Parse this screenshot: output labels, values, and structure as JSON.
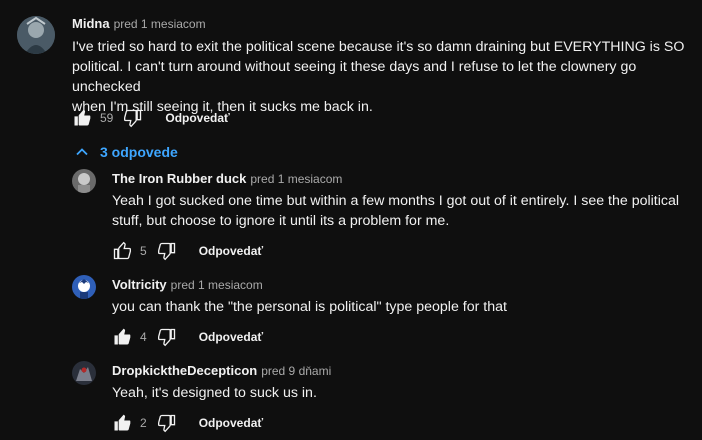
{
  "main_comment": {
    "author": "Midna",
    "time": "pred 1 mesiacom",
    "lines": [
      "I've tried so hard to exit the political scene because it's so damn draining but EVERYTHING is SO",
      "political. I can't turn around without seeing it these days and I refuse to let the clownery go unchecked",
      "when I'm still seeing it, then it sucks me back in."
    ],
    "likes": "59",
    "reply_label": "Odpovedať",
    "liked": true
  },
  "replies_toggle": {
    "label": "3 odpovede",
    "icon": "chevron-up-icon"
  },
  "replies": [
    {
      "author": "The Iron Rubber duck",
      "time": "pred 1 mesiacom",
      "lines": [
        "Yeah I got sucked one time but within a few months I got out of it entirely. I see the political",
        "stuff, but choose to ignore it until its a problem for me."
      ],
      "likes": "5",
      "reply_label": "Odpovedať",
      "liked": false
    },
    {
      "author": "Voltricity",
      "time": "pred 1 mesiacom",
      "lines": [
        "you can thank the \"the personal is political\" type people for that"
      ],
      "likes": "4",
      "reply_label": "Odpovedať",
      "liked": true
    },
    {
      "author": "DropkicktheDecepticon",
      "time": "pred 9 dňami",
      "lines": [
        "Yeah, it's designed to suck us in."
      ],
      "likes": "2",
      "reply_label": "Odpovedať",
      "liked": true
    }
  ],
  "colors": {
    "background": "#0f0f0f",
    "text": "#f1f1f1",
    "secondary": "#aaaaaa",
    "link": "#3ea6ff"
  }
}
